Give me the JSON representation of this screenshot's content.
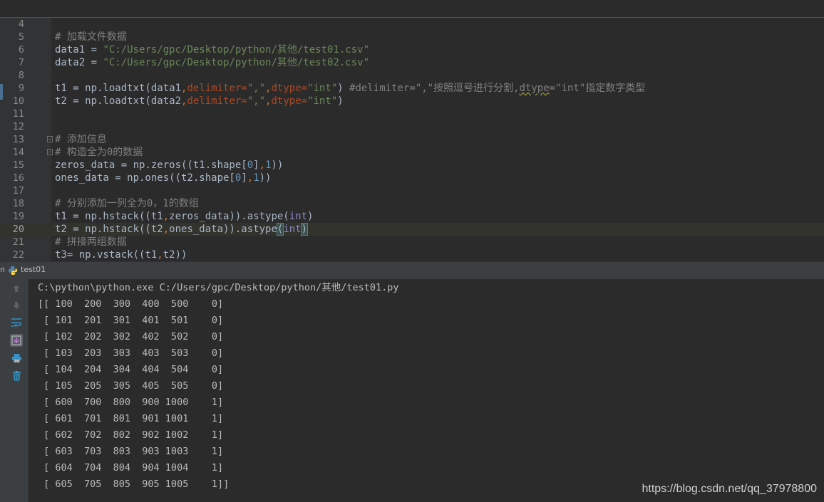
{
  "editor": {
    "lines": [
      {
        "no": "4",
        "tokens": []
      },
      {
        "no": "5",
        "tokens": [
          {
            "c": "t-comment",
            "t": "# 加载文件数据"
          }
        ]
      },
      {
        "no": "6",
        "tokens": [
          {
            "t": "data1 = "
          },
          {
            "c": "t-string",
            "t": "\"C:/Users/gpc/Desktop/python/其他/test01.csv\""
          }
        ]
      },
      {
        "no": "7",
        "tokens": [
          {
            "t": "data2 = "
          },
          {
            "c": "t-string",
            "t": "\"C:/Users/gpc/Desktop/python/其他/test02.csv\""
          }
        ]
      },
      {
        "no": "8",
        "tokens": []
      },
      {
        "no": "9",
        "tokens": [
          {
            "t": "t1 = np.loadtxt(data1"
          },
          {
            "c": "t-comma",
            "t": ","
          },
          {
            "c": "t-keyarg",
            "t": "delimiter="
          },
          {
            "c": "t-string",
            "t": "\",\""
          },
          {
            "c": "t-comma",
            "t": ","
          },
          {
            "c": "t-keyarg",
            "t": "dtype="
          },
          {
            "c": "t-string",
            "t": "\"int\""
          },
          {
            "t": ") "
          },
          {
            "c": "t-comment",
            "t": "#delimiter=\",\"按照逗号进行分割,"
          },
          {
            "c": "t-comment t-underline",
            "t": "dtype"
          },
          {
            "c": "t-comment",
            "t": "=\"int\"指定数字类型"
          }
        ]
      },
      {
        "no": "10",
        "tokens": [
          {
            "t": "t2 = np.loadtxt(data2"
          },
          {
            "c": "t-comma",
            "t": ","
          },
          {
            "c": "t-keyarg",
            "t": "delimiter="
          },
          {
            "c": "t-string",
            "t": "\",\""
          },
          {
            "c": "t-comma",
            "t": ","
          },
          {
            "c": "t-keyarg",
            "t": "dtype="
          },
          {
            "c": "t-string",
            "t": "\"int\""
          },
          {
            "t": ")"
          }
        ]
      },
      {
        "no": "11",
        "tokens": []
      },
      {
        "no": "12",
        "tokens": []
      },
      {
        "no": "13",
        "fold": true,
        "tokens": [
          {
            "c": "t-comment",
            "t": "# 添加信息"
          }
        ]
      },
      {
        "no": "14",
        "fold": true,
        "tokens": [
          {
            "c": "t-comment",
            "t": "# 构造全为0的数据"
          }
        ]
      },
      {
        "no": "15",
        "tokens": [
          {
            "t": "zeros_data = np.zeros((t1.shape["
          },
          {
            "c": "t-number",
            "t": "0"
          },
          {
            "t": "]"
          },
          {
            "c": "t-comma",
            "t": ","
          },
          {
            "c": "t-number",
            "t": "1"
          },
          {
            "t": "))"
          }
        ]
      },
      {
        "no": "16",
        "tokens": [
          {
            "t": "ones_data = np.ones((t2.shape["
          },
          {
            "c": "t-number",
            "t": "0"
          },
          {
            "t": "]"
          },
          {
            "c": "t-comma",
            "t": ","
          },
          {
            "c": "t-number",
            "t": "1"
          },
          {
            "t": "))"
          }
        ]
      },
      {
        "no": "17",
        "tokens": []
      },
      {
        "no": "18",
        "tokens": [
          {
            "c": "t-comment",
            "t": "# 分别添加一列全为0，1的数组"
          }
        ]
      },
      {
        "no": "19",
        "tokens": [
          {
            "t": "t1 = np.hstack((t1"
          },
          {
            "c": "t-comma",
            "t": ","
          },
          {
            "t": "zeros_data)).astype("
          },
          {
            "c": "t-builtin",
            "t": "int"
          },
          {
            "t": ")"
          }
        ]
      },
      {
        "no": "20",
        "current": true,
        "tokens": [
          {
            "t": "t2 = np.hstack((t2"
          },
          {
            "c": "t-comma",
            "t": ","
          },
          {
            "t": "ones_data)).astype"
          },
          {
            "c": "t-match",
            "t": "("
          },
          {
            "c": "t-builtin",
            "t": "int"
          },
          {
            "c": "t-match",
            "t": ")"
          }
        ]
      },
      {
        "no": "21",
        "tokens": [
          {
            "c": "t-comment",
            "t": "# 拼接两组数据"
          }
        ]
      },
      {
        "no": "22",
        "tokens": [
          {
            "t": "t3= np.vstack((t1"
          },
          {
            "c": "t-comma",
            "t": ","
          },
          {
            "t": "t2))"
          }
        ]
      }
    ]
  },
  "run_panel": {
    "prefix": "n",
    "title": "test01",
    "icons": [
      "up-arrow-icon",
      "down-arrow-icon",
      "soft-wrap-icon",
      "scroll-to-end-icon",
      "print-icon",
      "trash-icon"
    ]
  },
  "console": {
    "lines": [
      "C:\\python\\python.exe C:/Users/gpc/Desktop/python/其他/test01.py",
      "[[ 100  200  300  400  500    0]",
      " [ 101  201  301  401  501    0]",
      " [ 102  202  302  402  502    0]",
      " [ 103  203  303  403  503    0]",
      " [ 104  204  304  404  504    0]",
      " [ 105  205  305  405  505    0]",
      " [ 600  700  800  900 1000    1]",
      " [ 601  701  801  901 1001    1]",
      " [ 602  702  802  902 1002    1]",
      " [ 603  703  803  903 1003    1]",
      " [ 604  704  804  904 1004    1]",
      " [ 605  705  805  905 1005    1]]"
    ]
  },
  "watermark": "https://blog.csdn.net/qq_37978800"
}
